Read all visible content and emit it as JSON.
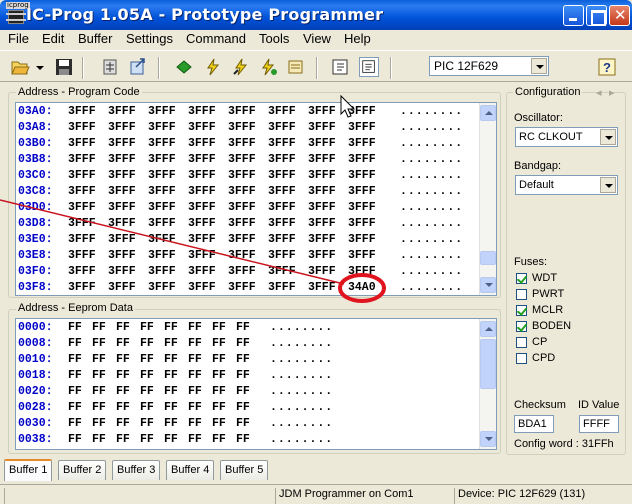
{
  "window": {
    "title": "IC-Prog 1.05A - Prototype Programmer",
    "icon_label": "icprog",
    "icon": "chip-icon"
  },
  "menu": [
    "File",
    "Edit",
    "Buffer",
    "Settings",
    "Command",
    "Tools",
    "View",
    "Help"
  ],
  "toolbar": {
    "device": "PIC 12F629",
    "icons": [
      "open-folder-icon",
      "save-icon",
      "import-icon",
      "export-icon",
      "read-icon",
      "program-icon",
      "erase-icon",
      "verify-icon",
      "blank-check-icon",
      "assembler-view-icon",
      "hex-view-icon",
      "help-icon"
    ]
  },
  "program_code": {
    "label": "Address - Program Code",
    "rows": [
      {
        "addr": "03A0:",
        "words": [
          "3FFF",
          "3FFF",
          "3FFF",
          "3FFF",
          "3FFF",
          "3FFF",
          "3FFF",
          "3FFF"
        ],
        "ascii": "........"
      },
      {
        "addr": "03A8:",
        "words": [
          "3FFF",
          "3FFF",
          "3FFF",
          "3FFF",
          "3FFF",
          "3FFF",
          "3FFF",
          "3FFF"
        ],
        "ascii": "........"
      },
      {
        "addr": "03B0:",
        "words": [
          "3FFF",
          "3FFF",
          "3FFF",
          "3FFF",
          "3FFF",
          "3FFF",
          "3FFF",
          "3FFF"
        ],
        "ascii": "........"
      },
      {
        "addr": "03B8:",
        "words": [
          "3FFF",
          "3FFF",
          "3FFF",
          "3FFF",
          "3FFF",
          "3FFF",
          "3FFF",
          "3FFF"
        ],
        "ascii": "........"
      },
      {
        "addr": "03C0:",
        "words": [
          "3FFF",
          "3FFF",
          "3FFF",
          "3FFF",
          "3FFF",
          "3FFF",
          "3FFF",
          "3FFF"
        ],
        "ascii": "........"
      },
      {
        "addr": "03C8:",
        "words": [
          "3FFF",
          "3FFF",
          "3FFF",
          "3FFF",
          "3FFF",
          "3FFF",
          "3FFF",
          "3FFF"
        ],
        "ascii": "........"
      },
      {
        "addr": "03D0:",
        "words": [
          "3FFF",
          "3FFF",
          "3FFF",
          "3FFF",
          "3FFF",
          "3FFF",
          "3FFF",
          "3FFF"
        ],
        "ascii": "........"
      },
      {
        "addr": "03D8:",
        "words": [
          "3FFF",
          "3FFF",
          "3FFF",
          "3FFF",
          "3FFF",
          "3FFF",
          "3FFF",
          "3FFF"
        ],
        "ascii": "........"
      },
      {
        "addr": "03E0:",
        "words": [
          "3FFF",
          "3FFF",
          "3FFF",
          "3FFF",
          "3FFF",
          "3FFF",
          "3FFF",
          "3FFF"
        ],
        "ascii": "........"
      },
      {
        "addr": "03E8:",
        "words": [
          "3FFF",
          "3FFF",
          "3FFF",
          "3FFF",
          "3FFF",
          "3FFF",
          "3FFF",
          "3FFF"
        ],
        "ascii": "........"
      },
      {
        "addr": "03F0:",
        "words": [
          "3FFF",
          "3FFF",
          "3FFF",
          "3FFF",
          "3FFF",
          "3FFF",
          "3FFF",
          "3FFF"
        ],
        "ascii": "........"
      },
      {
        "addr": "03F8:",
        "words": [
          "3FFF",
          "3FFF",
          "3FFF",
          "3FFF",
          "3FFF",
          "3FFF",
          "3FFF",
          "34A0"
        ],
        "ascii": "........"
      }
    ],
    "highlight": "34A0",
    "annotation_color": "#e0141e"
  },
  "eeprom": {
    "label": "Address - Eeprom Data",
    "rows": [
      {
        "addr": "0000:",
        "bytes": [
          "FF",
          "FF",
          "FF",
          "FF",
          "FF",
          "FF",
          "FF",
          "FF"
        ],
        "ascii": "........"
      },
      {
        "addr": "0008:",
        "bytes": [
          "FF",
          "FF",
          "FF",
          "FF",
          "FF",
          "FF",
          "FF",
          "FF"
        ],
        "ascii": "........"
      },
      {
        "addr": "0010:",
        "bytes": [
          "FF",
          "FF",
          "FF",
          "FF",
          "FF",
          "FF",
          "FF",
          "FF"
        ],
        "ascii": "........"
      },
      {
        "addr": "0018:",
        "bytes": [
          "FF",
          "FF",
          "FF",
          "FF",
          "FF",
          "FF",
          "FF",
          "FF"
        ],
        "ascii": "........"
      },
      {
        "addr": "0020:",
        "bytes": [
          "FF",
          "FF",
          "FF",
          "FF",
          "FF",
          "FF",
          "FF",
          "FF"
        ],
        "ascii": "........"
      },
      {
        "addr": "0028:",
        "bytes": [
          "FF",
          "FF",
          "FF",
          "FF",
          "FF",
          "FF",
          "FF",
          "FF"
        ],
        "ascii": "........"
      },
      {
        "addr": "0030:",
        "bytes": [
          "FF",
          "FF",
          "FF",
          "FF",
          "FF",
          "FF",
          "FF",
          "FF"
        ],
        "ascii": "........"
      },
      {
        "addr": "0038:",
        "bytes": [
          "FF",
          "FF",
          "FF",
          "FF",
          "FF",
          "FF",
          "FF",
          "FF"
        ],
        "ascii": "........"
      }
    ]
  },
  "config": {
    "label": "Configuration",
    "oscillator_label": "Oscillator:",
    "oscillator": "RC CLKOUT",
    "bandgap_label": "Bandgap:",
    "bandgap": "Default",
    "fuses_label": "Fuses:",
    "fuses": [
      {
        "name": "WDT",
        "checked": true
      },
      {
        "name": "PWRT",
        "checked": false
      },
      {
        "name": "MCLR",
        "checked": true
      },
      {
        "name": "BODEN",
        "checked": true
      },
      {
        "name": "CP",
        "checked": false
      },
      {
        "name": "CPD",
        "checked": false
      }
    ],
    "checksum_label": "Checksum",
    "checksum": "BDA1",
    "id_label": "ID Value",
    "id_value": "FFFF",
    "config_word": "Config word : 31FFh"
  },
  "tabs": [
    "Buffer 1",
    "Buffer 2",
    "Buffer 3",
    "Buffer 4",
    "Buffer 5"
  ],
  "active_tab": "Buffer 1",
  "status": {
    "programmer": "JDM Programmer on Com1",
    "device": "Device: PIC 12F629  (131)"
  }
}
